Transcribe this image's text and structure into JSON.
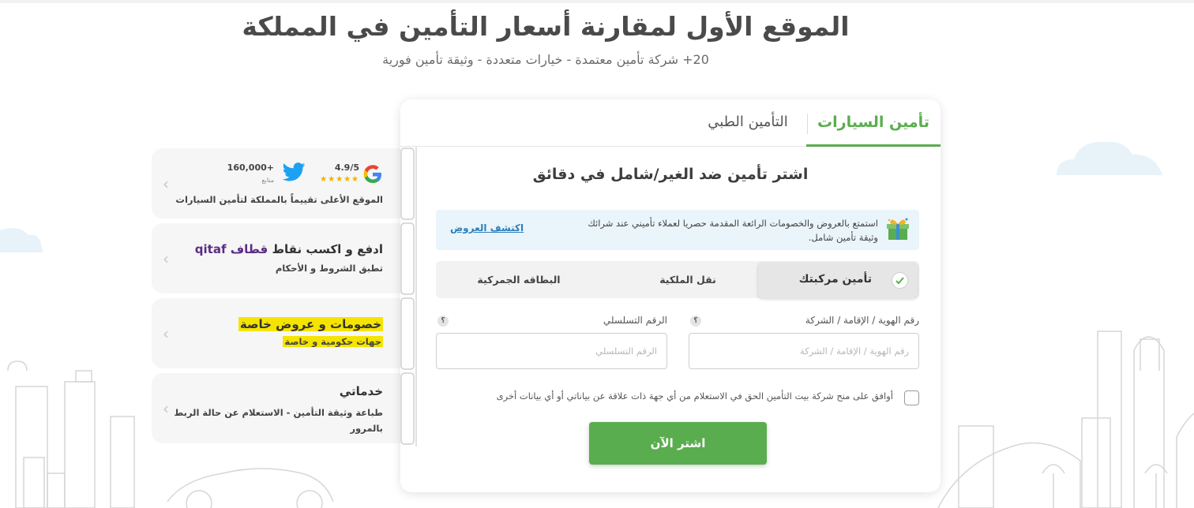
{
  "hero": {
    "title": "الموقع الأول لمقارنة أسعار التأمين في المملكة",
    "subtitle": "20+ شركة تأمين معتمدة - خيارات متعددة - وثيقة تأمين فورية"
  },
  "tabs": {
    "cars": "تأمين السيارات",
    "medical": "التأمين الطبي"
  },
  "form": {
    "title": "اشتر تأمين ضد الغير/شامل في دقائق",
    "promo": {
      "text": "استمتع بالعروض والخصومات الرائعة المقدمة حصريا لعملاء تأميني عند شرائك وثيقة تأمين شامل.",
      "link": "اكتشف العروض"
    },
    "segments": [
      "تأمين مركبتك",
      "نقل الملكية",
      "البطاقه الجمركية"
    ],
    "id_field": {
      "label": "رقم الهوية / الإقامة / الشركة",
      "placeholder": "رقم الهوية / الإقامة / الشركة"
    },
    "serial_field": {
      "label": "الرقم التسلسلي",
      "placeholder": "الرقم التسلسلي"
    },
    "help_glyph": "؟",
    "agree_text": "أوافق على منح شركة بيت التأمين الحق في الاستعلام من أي جهة ذات علاقة عن بياناتي أو أي بيانات أخرى",
    "buy_button": "اشتر الآن"
  },
  "features": {
    "rating": {
      "google_score": "4.9/5",
      "twitter_followers": "160,000+",
      "followers_label": "متابع",
      "text": "الموقع الأعلى تقييماً بالمملكة لتأمين السيارات"
    },
    "qitaf": {
      "title": "ادفع و اكسب نقاط",
      "logo": "قطاف qitaf",
      "sub": "تطبق الشروط و الأحكام"
    },
    "discounts": {
      "title": "خصومات و عروض خاصة",
      "sub": "جهات حكومية و خاصة"
    },
    "services": {
      "title": "خدماتي",
      "sub": "طباعة وثيقة التأمين - الاستعلام عن حالة الربط بالمرور"
    }
  },
  "colors": {
    "brand_green": "#5aad4e",
    "highlight_yellow": "#f5e400",
    "qitaf_purple": "#5b2c83",
    "link_blue": "#2d7fb8"
  }
}
